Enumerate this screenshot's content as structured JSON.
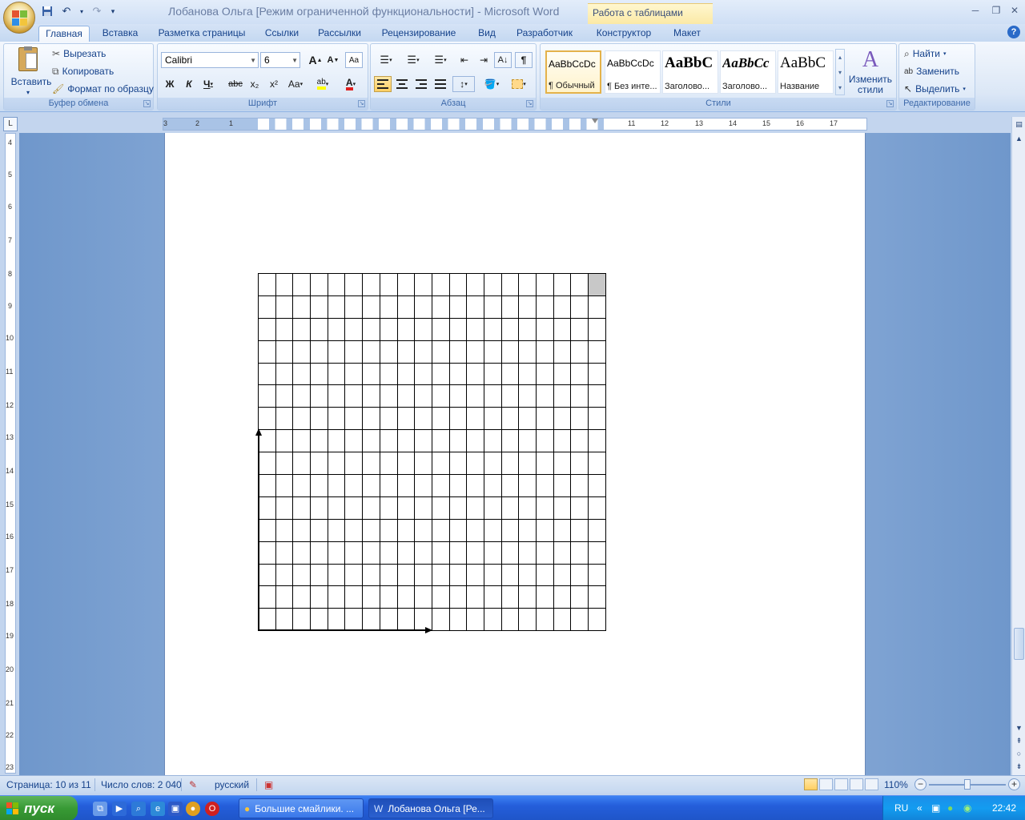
{
  "window": {
    "title": "Лобанова Ольга [Режим ограниченной функциональности] - Microsoft Word",
    "context_group": "Работа с таблицами"
  },
  "tabs": [
    "Главная",
    "Вставка",
    "Разметка страницы",
    "Ссылки",
    "Рассылки",
    "Рецензирование",
    "Вид",
    "Разработчик",
    "Конструктор",
    "Макет"
  ],
  "clipboard": {
    "paste": "Вставить",
    "cut": "Вырезать",
    "copy": "Копировать",
    "format_painter": "Формат по образцу",
    "label": "Буфер обмена"
  },
  "font": {
    "name": "Calibri",
    "size": "6",
    "label": "Шрифт",
    "bold": "Ж",
    "italic": "К",
    "underline": "Ч",
    "strike": "abc",
    "sub": "x₂",
    "sup": "x²",
    "case": "Aa",
    "grow": "A",
    "shrink": "A",
    "highlight": "ab",
    "color": "A"
  },
  "paragraph": {
    "label": "Абзац",
    "pilcrow": "¶"
  },
  "styles": {
    "label": "Стили",
    "items": [
      {
        "sample": "AaBbCcDc",
        "name": "¶ Обычный"
      },
      {
        "sample": "AaBbCcDc",
        "name": "¶ Без инте..."
      },
      {
        "sample": "AaBbC",
        "name": "Заголово..."
      },
      {
        "sample": "AaBbCc",
        "name": "Заголово..."
      },
      {
        "sample": "AaBbC",
        "name": "Название"
      }
    ],
    "change": "Изменить стили"
  },
  "editing": {
    "find": "Найти",
    "replace": "Заменить",
    "select": "Выделить",
    "label": "Редактирование"
  },
  "ruler": {
    "h_numbers": [
      "3",
      "2",
      "1",
      "11",
      "12",
      "13",
      "14",
      "15",
      "16",
      "17"
    ],
    "v_numbers": [
      "4",
      "5",
      "6",
      "7",
      "8",
      "9",
      "10",
      "11",
      "12",
      "13",
      "14",
      "15",
      "16",
      "17",
      "18",
      "19",
      "20",
      "21",
      "22",
      "23"
    ]
  },
  "table": {
    "rows": 16,
    "cols": 20,
    "shaded_cell": [
      0,
      19
    ]
  },
  "status": {
    "page": "Страница: 10 из 11",
    "words": "Число слов: 2 040",
    "lang": "русский",
    "zoom": "110%"
  },
  "taskbar": {
    "start": "пуск",
    "tasks": [
      "Большие смайлики. ...",
      "Лобанова Ольга [Ре..."
    ],
    "lang": "RU",
    "time": "22:42"
  }
}
